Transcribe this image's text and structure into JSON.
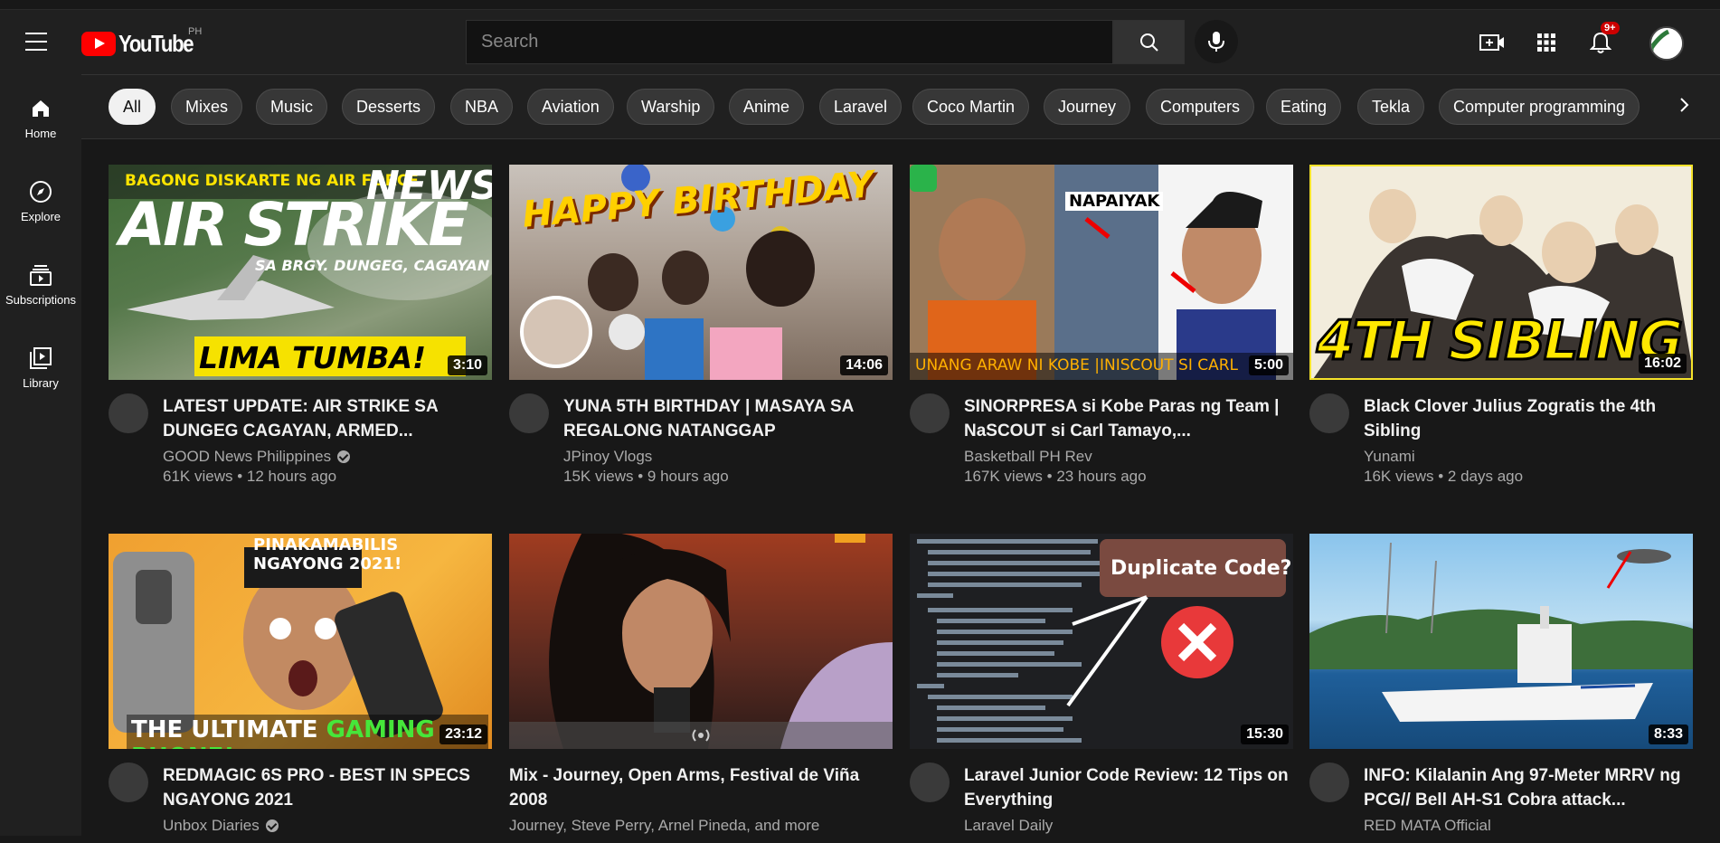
{
  "header": {
    "logo_text": "YouTube",
    "region": "PH",
    "search_placeholder": "Search",
    "notification_count": "9+"
  },
  "icons": [
    "menu-icon",
    "youtube-logo-icon",
    "search-icon",
    "mic-icon",
    "create-icon",
    "apps-icon",
    "bell-icon"
  ],
  "sidebar": {
    "items": [
      {
        "label": "Home",
        "icon": "home-icon"
      },
      {
        "label": "Explore",
        "icon": "compass-icon"
      },
      {
        "label": "Subscriptions",
        "icon": "subscriptions-icon"
      },
      {
        "label": "Library",
        "icon": "library-icon"
      }
    ]
  },
  "chips": [
    "All",
    "Mixes",
    "Music",
    "Desserts",
    "NBA",
    "Aviation",
    "Warship",
    "Anime",
    "Laravel",
    "Coco Martin",
    "Journey",
    "Computers",
    "Eating",
    "Tekla",
    "Computer programming"
  ],
  "videos": [
    {
      "title": "LATEST UPDATE: AIR STRIKE SA DUNGEG CAGAYAN, ARMED...",
      "channel": "GOOD News Philippines",
      "verified": true,
      "views": "61K views",
      "age": "12 hours ago",
      "duration": "3:10",
      "thumb_text": [
        "BAGONG DISKARTE NG AIR FORCE",
        "NEWS",
        "AIR STRIKE",
        "SA BRGY. DUNGEG, CAGAYAN",
        "LIMA TUMBA!"
      ]
    },
    {
      "title": "YUNA 5TH BIRTHDAY | MASAYA SA REGALONG NATANGGAP",
      "channel": "JPinoy Vlogs",
      "verified": false,
      "views": "15K views",
      "age": "9 hours ago",
      "duration": "14:06",
      "thumb_text": [
        "HAPPY BIRTHDAY"
      ]
    },
    {
      "title": "SINORPRESA si Kobe Paras ng Team | NaSCOUT si Carl Tamayo,...",
      "channel": "Basketball PH Rev",
      "verified": false,
      "views": "167K views",
      "age": "23 hours ago",
      "duration": "5:00",
      "thumb_text": [
        "NAPAIYAK",
        "UNANG ARAW NI KOBE |INISCOUT SI CARL"
      ]
    },
    {
      "title": "Black Clover Julius Zogratis the 4th Sibling",
      "channel": "Yunami",
      "verified": false,
      "views": "16K views",
      "age": "2 days ago",
      "duration": "16:02",
      "thumb_text": [
        "4TH SIBLING"
      ]
    },
    {
      "title": "REDMAGIC 6S PRO - BEST IN SPECS NGAYONG 2021",
      "channel": "Unbox Diaries",
      "verified": true,
      "views": "",
      "age": "",
      "duration": "23:12",
      "thumb_text": [
        "PINAKAMABILIS NGAYONG 2021!",
        "THE ULTIMATE",
        "GAMING PHONE!"
      ]
    },
    {
      "title": "Mix - Journey, Open Arms, Festival de Viña 2008",
      "channel": "Journey, Steve Perry, Arnel Pineda, and more",
      "verified": false,
      "views": "",
      "age": "",
      "duration": "",
      "thumb_text": []
    },
    {
      "title": "Laravel Junior Code Review: 12 Tips on Everything",
      "channel": "Laravel Daily",
      "verified": false,
      "views": "",
      "age": "",
      "duration": "15:30",
      "thumb_text": [
        "Duplicate Code?"
      ]
    },
    {
      "title": "INFO: Kilalanin Ang 97-Meter MRRV ng PCG// Bell AH-S1 Cobra attack...",
      "channel": "RED MATA Official",
      "verified": false,
      "views": "",
      "age": "",
      "duration": "8:33",
      "thumb_text": []
    }
  ],
  "colors": {
    "background": "#181818",
    "header": "#202020",
    "brand_red": "#ff0000",
    "chip": "#373737",
    "chip_active": "#f1f1f1"
  }
}
